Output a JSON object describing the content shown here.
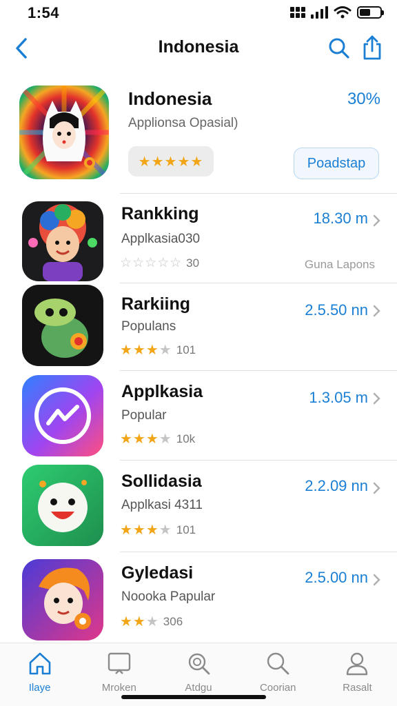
{
  "status": {
    "time": "1:54"
  },
  "nav": {
    "title": "Indonesia",
    "back_icon": "chevron-left-icon",
    "search_icon": "search-icon",
    "share_icon": "share-icon"
  },
  "featured": {
    "name": "Indonesia",
    "subtitle": "Applionsa Opasial)",
    "percent": "30%",
    "stars": "★★★★★",
    "action_label": "Poadstap"
  },
  "list": [
    {
      "name": "Rankking",
      "subtitle": "Applkasia030",
      "size": "18.30 m",
      "rating_text": "30",
      "extra": "Guna Lapons",
      "stars_filled": 0
    },
    {
      "name": "Rarkiing",
      "subtitle": "Populans",
      "size": "2.5.50 nn",
      "rating_text": "101",
      "stars_filled": 3.5
    },
    {
      "name": "Applkasia",
      "subtitle": "Popular",
      "size": "1.3.05 m",
      "rating_text": "10k",
      "stars_filled": 3.5
    },
    {
      "name": "Sollidasia",
      "subtitle": "Applkasi 4311",
      "size": "2.2.09 nn",
      "rating_text": "101",
      "stars_filled": 3.5
    },
    {
      "name": "Gyledasi",
      "subtitle": "Noooka Papular",
      "size": "2.5.00 nn",
      "rating_text": "306",
      "stars_filled": 2.5
    }
  ],
  "tabs": [
    {
      "label": "Ilaye",
      "icon": "home-icon",
      "active": true
    },
    {
      "label": "Mroken",
      "icon": "monitor-icon",
      "active": false
    },
    {
      "label": "Atdgu",
      "icon": "magnify-icon",
      "active": false
    },
    {
      "label": "Coorian",
      "icon": "search-icon",
      "active": false
    },
    {
      "label": "Rasalt",
      "icon": "person-icon",
      "active": false
    }
  ],
  "colors": {
    "accent": "#1a7fd4",
    "star": "#f2a516"
  }
}
